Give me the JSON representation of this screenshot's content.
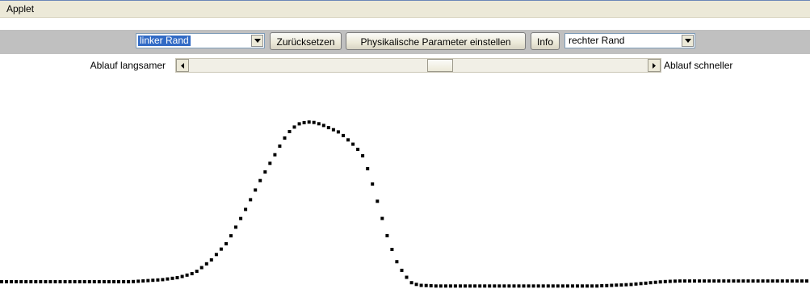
{
  "menubar": {
    "items": [
      "Applet"
    ]
  },
  "toolbar": {
    "left_select": {
      "value": "linker Rand"
    },
    "reset_label": "Zurücksetzen",
    "params_label": "Physikalische Parameter einstellen",
    "info_label": "Info",
    "right_select": {
      "value": "rechter Rand"
    }
  },
  "speed": {
    "slower_label": "Ablauf langsamer",
    "faster_label": "Ablauf schneller",
    "value": 0.55
  },
  "colors": {
    "toolbar_bg": "#c0c0c0",
    "selection": "#316ac5",
    "wave_dots": "#000000"
  },
  "wave": {
    "description_shape": "gaussian pulse followed by dip",
    "points": [
      [
        0,
        0.0
      ],
      [
        0.02,
        0.0
      ],
      [
        0.04,
        0.0
      ],
      [
        0.06,
        0.0
      ],
      [
        0.08,
        0.0
      ],
      [
        0.1,
        0.0
      ],
      [
        0.12,
        0.0
      ],
      [
        0.14,
        0.0
      ],
      [
        0.16,
        0.0
      ],
      [
        0.18,
        0.003
      ],
      [
        0.2,
        0.006
      ],
      [
        0.22,
        0.012
      ],
      [
        0.24,
        0.025
      ],
      [
        0.26,
        0.06
      ],
      [
        0.28,
        0.11
      ],
      [
        0.3,
        0.19
      ],
      [
        0.32,
        0.28
      ],
      [
        0.34,
        0.36
      ],
      [
        0.35,
        0.4
      ],
      [
        0.36,
        0.43
      ],
      [
        0.37,
        0.445
      ],
      [
        0.38,
        0.45
      ],
      [
        0.39,
        0.448
      ],
      [
        0.4,
        0.44
      ],
      [
        0.42,
        0.42
      ],
      [
        0.43,
        0.4
      ],
      [
        0.44,
        0.38
      ],
      [
        0.45,
        0.35
      ],
      [
        0.46,
        0.28
      ],
      [
        0.47,
        0.2
      ],
      [
        0.48,
        0.12
      ],
      [
        0.49,
        0.06
      ],
      [
        0.5,
        0.02
      ],
      [
        0.51,
        -0.005
      ],
      [
        0.52,
        -0.01
      ],
      [
        0.54,
        -0.012
      ],
      [
        0.56,
        -0.012
      ],
      [
        0.58,
        -0.012
      ],
      [
        0.6,
        -0.012
      ],
      [
        0.62,
        -0.012
      ],
      [
        0.64,
        -0.012
      ],
      [
        0.66,
        -0.012
      ],
      [
        0.68,
        -0.012
      ],
      [
        0.7,
        -0.012
      ],
      [
        0.72,
        -0.012
      ],
      [
        0.74,
        -0.012
      ],
      [
        0.76,
        -0.01
      ],
      [
        0.78,
        -0.008
      ],
      [
        0.8,
        -0.004
      ],
      [
        0.82,
        0.0
      ],
      [
        0.84,
        0.002
      ],
      [
        0.86,
        0.002
      ],
      [
        0.88,
        0.002
      ],
      [
        0.9,
        0.002
      ],
      [
        0.92,
        0.002
      ],
      [
        0.94,
        0.002
      ],
      [
        0.96,
        0.002
      ],
      [
        0.98,
        0.002
      ],
      [
        1.0,
        0.002
      ]
    ]
  }
}
